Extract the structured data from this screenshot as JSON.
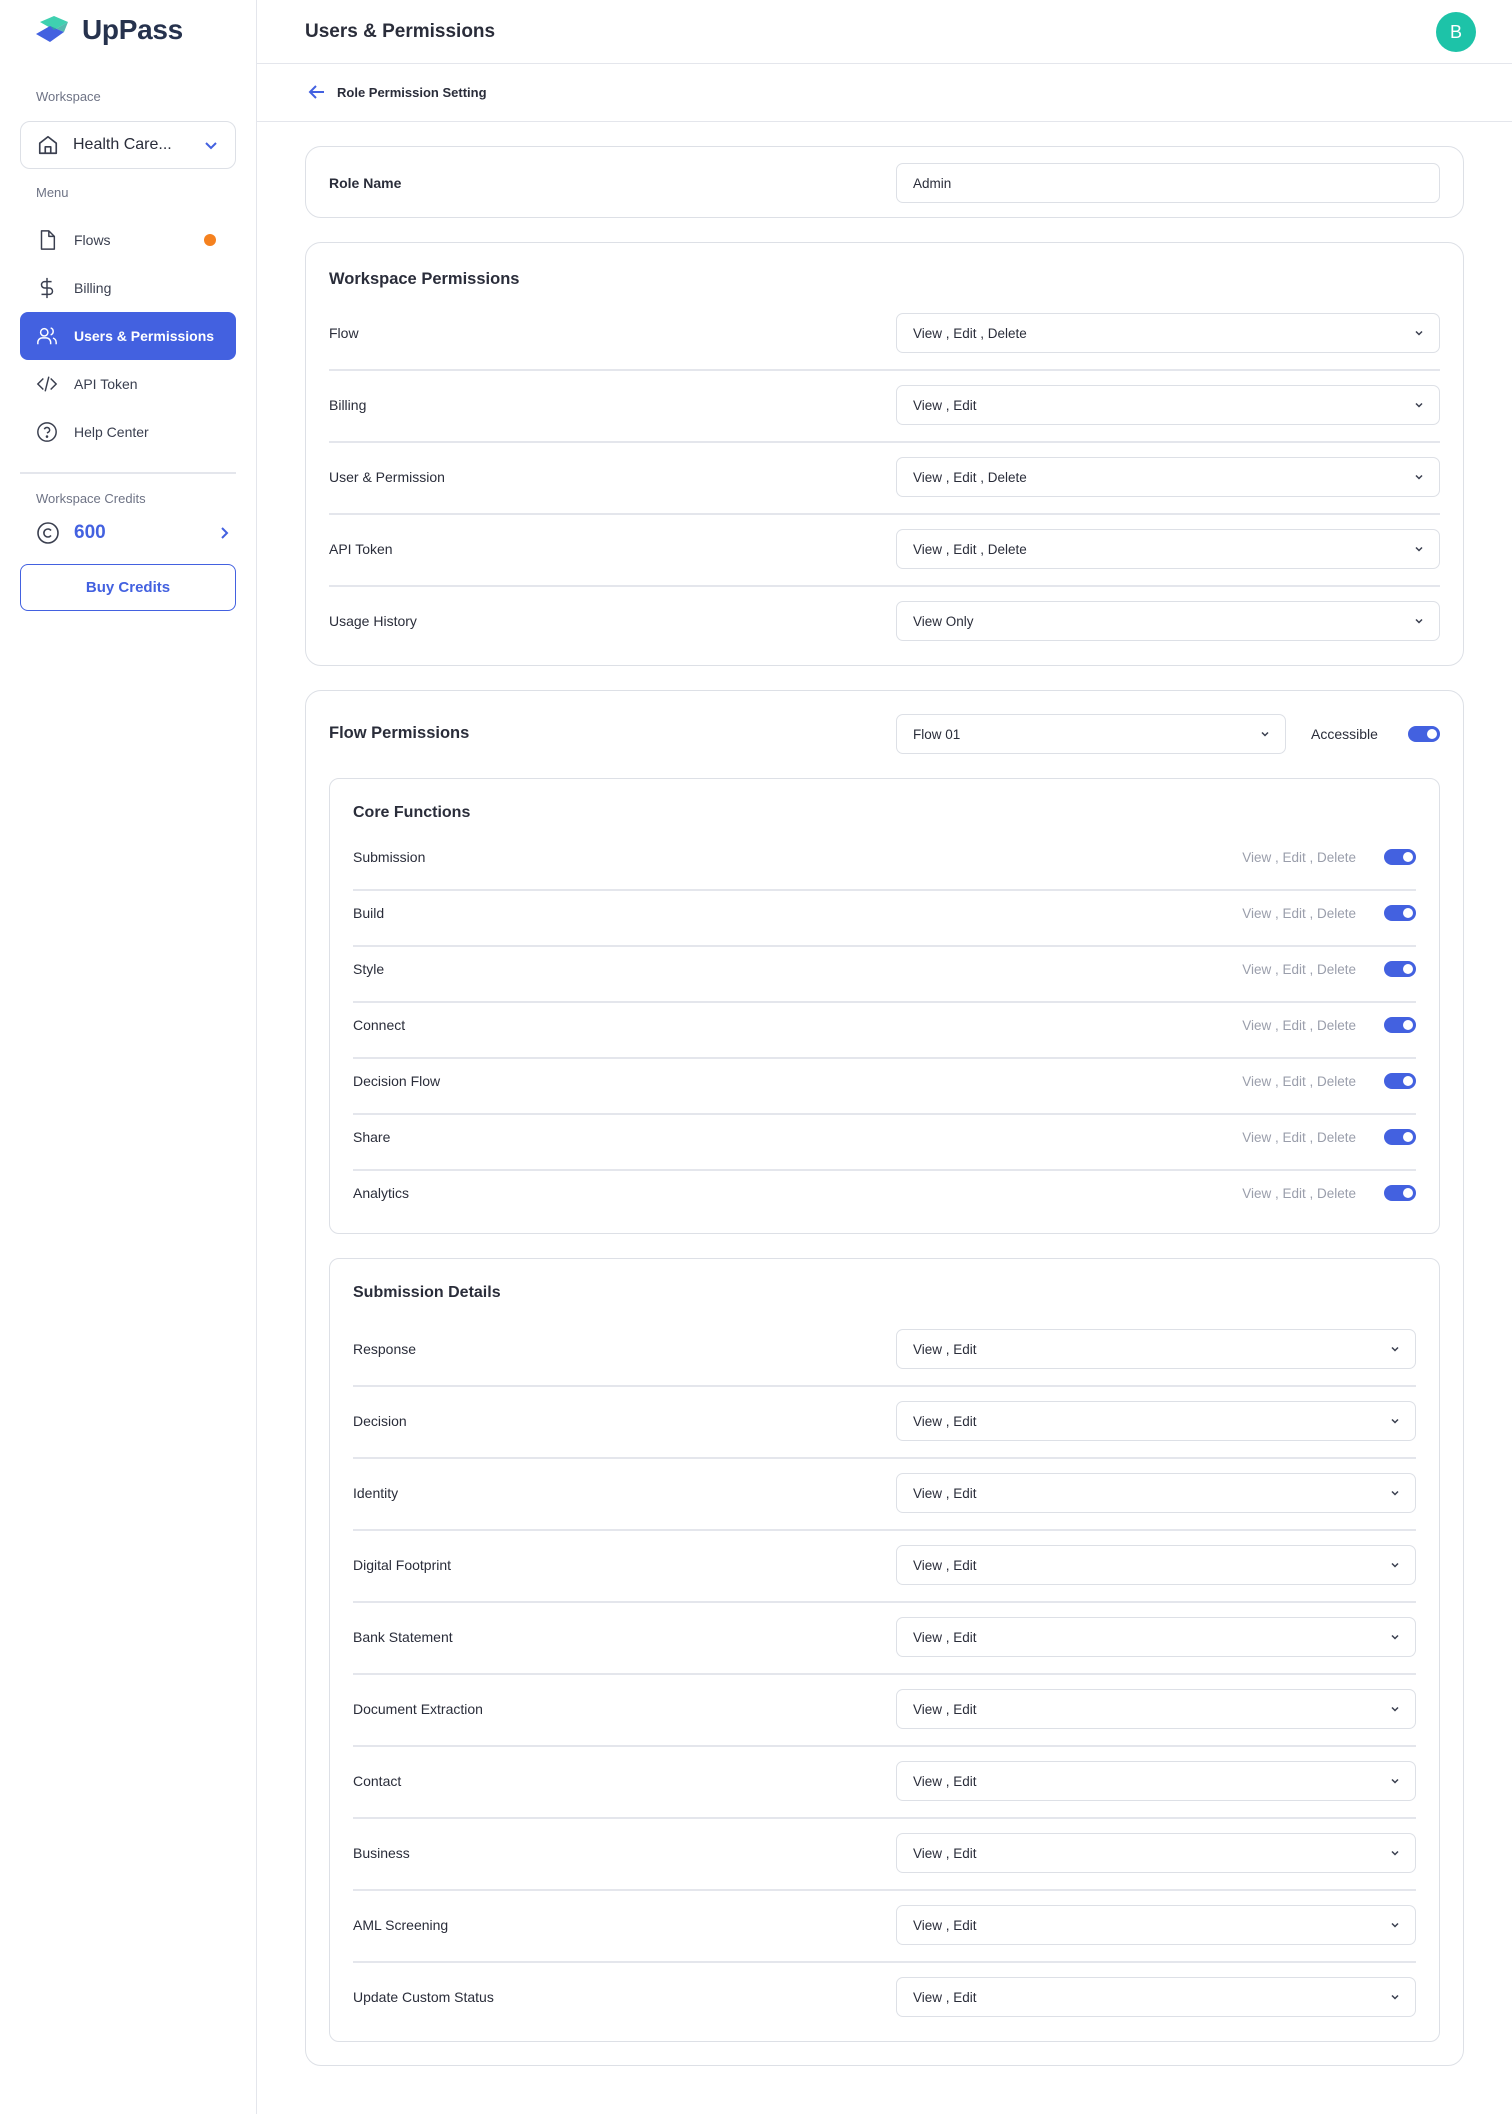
{
  "app": {
    "name": "UpPass"
  },
  "sidebar": {
    "workspace_label": "Workspace",
    "workspace_name": "Health Care...",
    "menu_label": "Menu",
    "items": [
      {
        "label": "Flows",
        "icon": "file-icon",
        "has_dot": true
      },
      {
        "label": "Billing",
        "icon": "dollar-icon"
      },
      {
        "label": "Users & Permissions",
        "icon": "users-icon",
        "active": true
      },
      {
        "label": "API Token",
        "icon": "code-icon"
      },
      {
        "label": "Help Center",
        "icon": "help-circle-icon"
      }
    ],
    "credits_label": "Workspace Credits",
    "credits_value": "600",
    "buy_credits": "Buy Credits"
  },
  "header": {
    "title": "Users & Permissions",
    "avatar_initial": "B"
  },
  "breadcrumb": {
    "back_label": "Role Permission Setting"
  },
  "role": {
    "label": "Role Name",
    "value": "Admin"
  },
  "workspace_permissions": {
    "title": "Workspace Permissions",
    "rows": [
      {
        "label": "Flow",
        "value": "View , Edit , Delete"
      },
      {
        "label": "Billing",
        "value": "View , Edit"
      },
      {
        "label": "User & Permission",
        "value": "View , Edit , Delete"
      },
      {
        "label": "API Token",
        "value": "View , Edit , Delete"
      },
      {
        "label": "Usage History",
        "value": "View Only"
      }
    ]
  },
  "flow_permissions": {
    "title": "Flow Permissions",
    "selected_flow": "Flow 01",
    "accessible_label": "Accessible",
    "accessible": true,
    "core_functions": {
      "title": "Core Functions",
      "rows": [
        {
          "label": "Submission",
          "perms": "View , Edit , Delete",
          "enabled": true
        },
        {
          "label": "Build",
          "perms": "View , Edit , Delete",
          "enabled": true
        },
        {
          "label": "Style",
          "perms": "View , Edit , Delete",
          "enabled": true
        },
        {
          "label": "Connect",
          "perms": "View , Edit , Delete",
          "enabled": true
        },
        {
          "label": "Decision Flow",
          "perms": "View , Edit , Delete",
          "enabled": true
        },
        {
          "label": "Share",
          "perms": "View , Edit , Delete",
          "enabled": true
        },
        {
          "label": "Analytics",
          "perms": "View , Edit , Delete",
          "enabled": true
        }
      ]
    },
    "submission_details": {
      "title": "Submission Details",
      "rows": [
        {
          "label": "Response",
          "value": "View , Edit"
        },
        {
          "label": "Decision",
          "value": "View , Edit"
        },
        {
          "label": "Identity",
          "value": "View , Edit"
        },
        {
          "label": "Digital Footprint",
          "value": "View , Edit"
        },
        {
          "label": "Bank Statement",
          "value": "View , Edit"
        },
        {
          "label": "Document Extraction",
          "value": "View , Edit"
        },
        {
          "label": "Contact",
          "value": "View , Edit"
        },
        {
          "label": "Business",
          "value": "View , Edit"
        },
        {
          "label": "AML Screening",
          "value": "View , Edit"
        },
        {
          "label": "Update Custom Status",
          "value": "View , Edit"
        }
      ]
    }
  },
  "colors": {
    "accent": "#4361e0",
    "avatar": "#1dc3a8",
    "notification_dot": "#f5811f"
  }
}
